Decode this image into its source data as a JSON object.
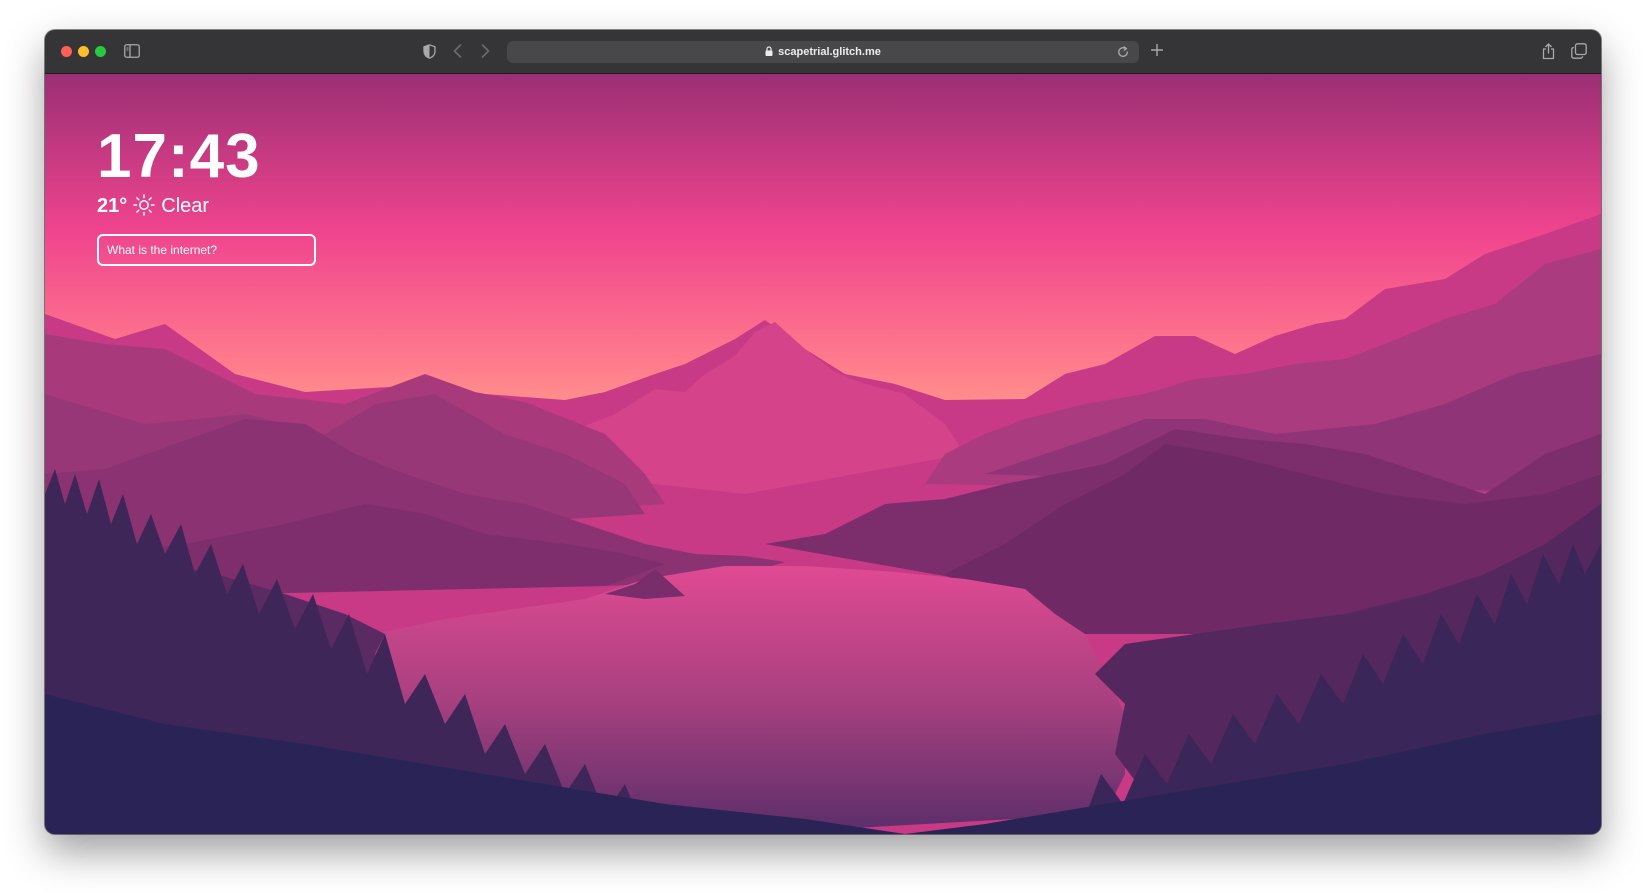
{
  "browser": {
    "url": "scapetrial.glitch.me",
    "icons": [
      "sidebar-icon",
      "shield-icon",
      "chevron-left-icon",
      "chevron-right-icon",
      "lock-icon",
      "reload-icon",
      "plus-icon",
      "share-icon",
      "tabs-icon"
    ]
  },
  "page": {
    "time": "17:43",
    "temperature": "21°",
    "weather_icon": "sun-icon",
    "condition": "Clear",
    "search_placeholder": "What is the internet?"
  },
  "colors": {
    "sky_top": "#9b2f74",
    "sky_mid": "#f0448e",
    "horizon": "#ff8f8a",
    "deep_forest": "#2a2456",
    "traffic_red": "#ff5f57",
    "traffic_yellow": "#febc2e",
    "traffic_green": "#28c840"
  }
}
